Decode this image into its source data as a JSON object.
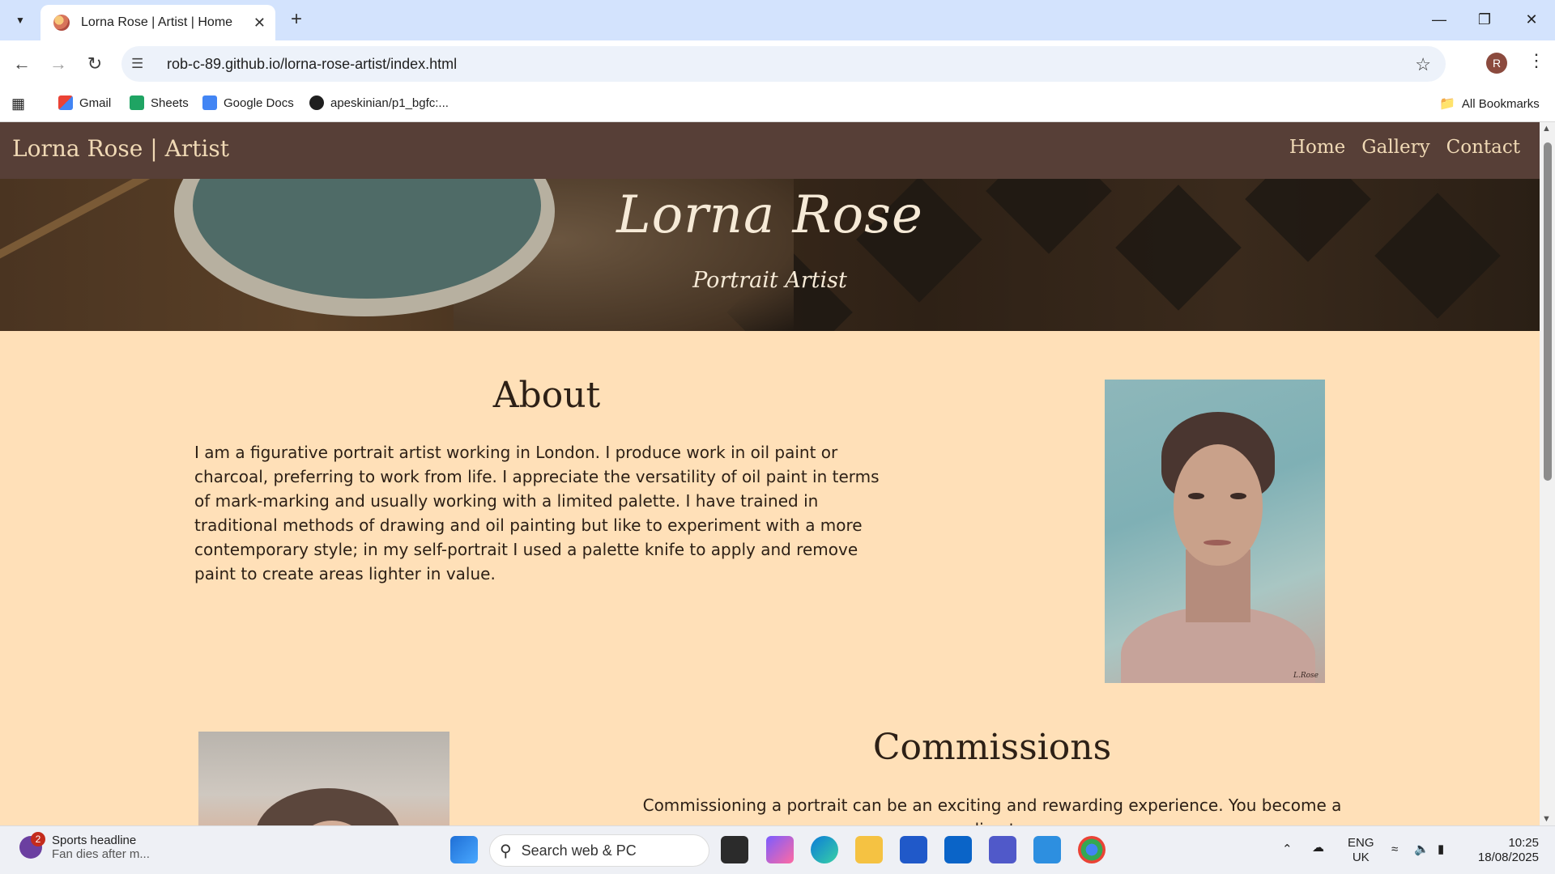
{
  "browser": {
    "tab_title": "Lorna Rose | Artist | Home",
    "url": "rob-c-89.github.io/lorna-rose-artist/index.html",
    "profile_initial": "R",
    "bookmarks": [
      {
        "label": "Gmail"
      },
      {
        "label": "Sheets"
      },
      {
        "label": "Google Docs"
      },
      {
        "label": "apeskinian/p1_bgfc:..."
      }
    ],
    "all_bookmarks": "All Bookmarks"
  },
  "site": {
    "brand": "Lorna Rose | Artist",
    "nav": [
      "Home",
      "Gallery",
      "Contact"
    ],
    "hero_title": "Lorna Rose",
    "hero_subtitle": "Portrait Artist",
    "about_heading": "About",
    "about_text": "I am a figurative portrait artist working in London. I produce work in oil paint or charcoal, preferring to work from life. I appreciate the versatility of oil paint in terms of mark-marking and usually working with a limited palette. I have trained in traditional methods of drawing and oil painting but like to experiment with a more contemporary style; in my self-portrait I used a palette knife to apply and remove paint to create areas lighter in value.",
    "commissions_heading": "Commissions",
    "commissions_text": "Commissioning a portrait can be an exciting and rewarding experience. You become a direct"
  },
  "taskbar": {
    "news_badge": "2",
    "news_title": "Sports headline",
    "news_sub": "Fan dies after m...",
    "search_placeholder": "Search web & PC",
    "lang1": "ENG",
    "lang2": "UK",
    "time": "10:25",
    "date": "18/08/2025"
  },
  "colors": {
    "nav_bg": "#573f37",
    "page_bg": "#ffe0b8",
    "accent_text": "#f0d9b5"
  }
}
